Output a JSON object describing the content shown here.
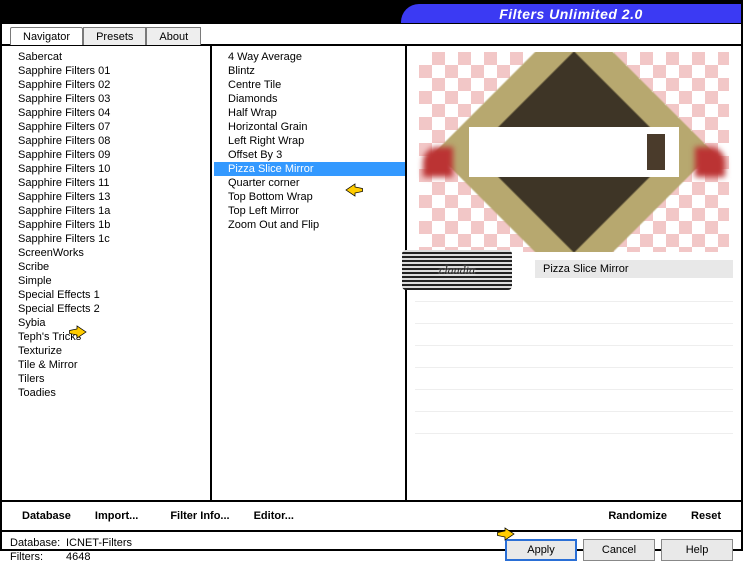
{
  "app_title": "Filters Unlimited 2.0",
  "tabs": {
    "navigator": "Navigator",
    "presets": "Presets",
    "about": "About"
  },
  "category_list": [
    "Sabercat",
    "Sapphire Filters 01",
    "Sapphire Filters 02",
    "Sapphire Filters 03",
    "Sapphire Filters 04",
    "Sapphire Filters 07",
    "Sapphire Filters 08",
    "Sapphire Filters 09",
    "Sapphire Filters 10",
    "Sapphire Filters 11",
    "Sapphire Filters 13",
    "Sapphire Filters 1a",
    "Sapphire Filters 1b",
    "Sapphire Filters 1c",
    "ScreenWorks",
    "Scribe",
    "Simple",
    "Special Effects 1",
    "Special Effects 2",
    "Sybia",
    "Teph's Tricks",
    "Texturize",
    "Tile & Mirror",
    "Tilers",
    "Toadies"
  ],
  "category_selected_index": 16,
  "filter_list": [
    "4 Way Average",
    "Blintz",
    "Centre Tile",
    "Diamonds",
    "Half Wrap",
    "Horizontal Grain",
    "Left Right Wrap",
    "Offset By 3",
    "Pizza Slice Mirror",
    "Quarter corner",
    "Top Bottom Wrap",
    "Top Left Mirror",
    "Zoom Out and Flip"
  ],
  "filter_selected_index": 8,
  "selected_filter_label": "Pizza Slice Mirror",
  "toolbar": {
    "database": "Database",
    "import": "Import...",
    "filter_info": "Filter Info...",
    "editor": "Editor...",
    "randomize": "Randomize",
    "reset": "Reset"
  },
  "status": {
    "database_label": "Database:",
    "database_value": "ICNET-Filters",
    "filters_label": "Filters:",
    "filters_value": "4648"
  },
  "buttons": {
    "apply": "Apply",
    "cancel": "Cancel",
    "help": "Help"
  },
  "watermark_text": "claudia"
}
